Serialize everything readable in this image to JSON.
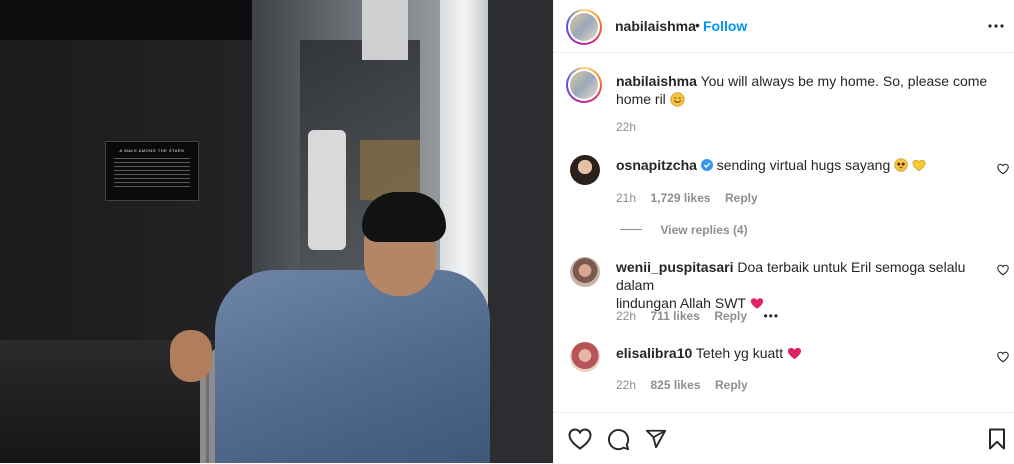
{
  "post": {
    "author": "nabilaishma",
    "follow_label": "Follow",
    "dot_separator": "•",
    "plaque_title": "A WALK AMONG THE STARS"
  },
  "caption": {
    "username": "nabilaishma",
    "text": "You will always be my home. So, please come home ril",
    "time": "22h"
  },
  "comments": [
    {
      "username": "osnapitzcha",
      "verified": true,
      "text": "sending virtual hugs sayang",
      "time": "21h",
      "likes": "1,729 likes",
      "reply": "Reply"
    },
    {
      "username": "wenii_puspitasari",
      "verified": false,
      "text_line1": "Doa terbaik untuk Eril semoga selalu dalam",
      "text_line2": "lindungan Allah SWT",
      "time": "22h",
      "likes": "711 likes",
      "reply": "Reply",
      "more": "•••"
    },
    {
      "username": "elisalibra10",
      "verified": false,
      "text": "Teteh yg kuatt",
      "time": "22h",
      "likes": "825 likes",
      "reply": "Reply"
    }
  ],
  "view_replies": "View replies (4)",
  "colors": {
    "link_blue": "#0095f6",
    "muted": "#8e8e8e",
    "text": "#262626",
    "heart_red": "#ed4956",
    "verified_blue": "#3897f0"
  },
  "icons": [
    "more-options-icon",
    "like-icon",
    "comment-icon",
    "share-icon",
    "save-icon",
    "comment-like-icon",
    "verified-badge-icon"
  ]
}
